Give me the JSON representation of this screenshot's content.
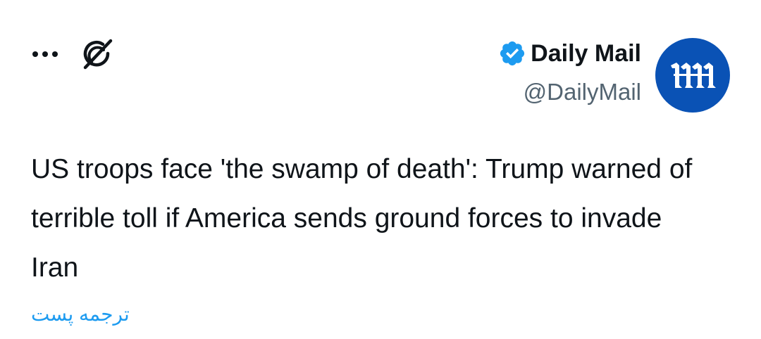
{
  "author": {
    "display_name": "Daily Mail",
    "handle": "@DailyMail",
    "verified_icon": "verified-badge-icon",
    "avatar_icon": "daily-mail-logo",
    "avatar_color": "#0a52b5"
  },
  "actions": {
    "more_icon": "more-dots-icon",
    "grok_icon": "grok-icon"
  },
  "tweet": {
    "text": "US troops face 'the swamp of death': Trump warned of terrible toll if America sends ground forces to invade Iran",
    "translate_label": "ترجمه پست"
  },
  "colors": {
    "link": "#1d9bf0",
    "text": "#0f1419",
    "secondary": "#536471",
    "verified": "#1d9bf0"
  }
}
